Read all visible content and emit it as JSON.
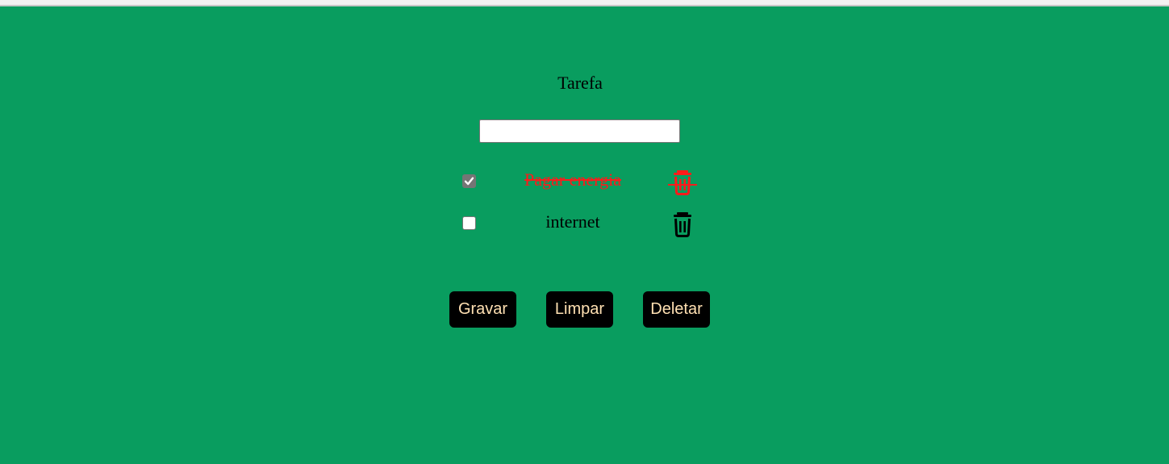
{
  "header": {
    "title": "Tarefa"
  },
  "task_input": {
    "value": "",
    "placeholder": ""
  },
  "tasks": [
    {
      "label": "Pagar energia",
      "checked": true,
      "color": "#ff1a1a",
      "icon": "trash-icon"
    },
    {
      "label": "internet",
      "checked": false,
      "color": "#000000",
      "icon": "trash-icon"
    }
  ],
  "buttons": {
    "save_label": "Gravar",
    "clear_label": "Limpar",
    "delete_label": "Deletar"
  },
  "colors": {
    "background": "#099d5f",
    "button_bg": "#000000",
    "button_text": "#ffe0b2",
    "done_text": "#ff1a1a"
  }
}
